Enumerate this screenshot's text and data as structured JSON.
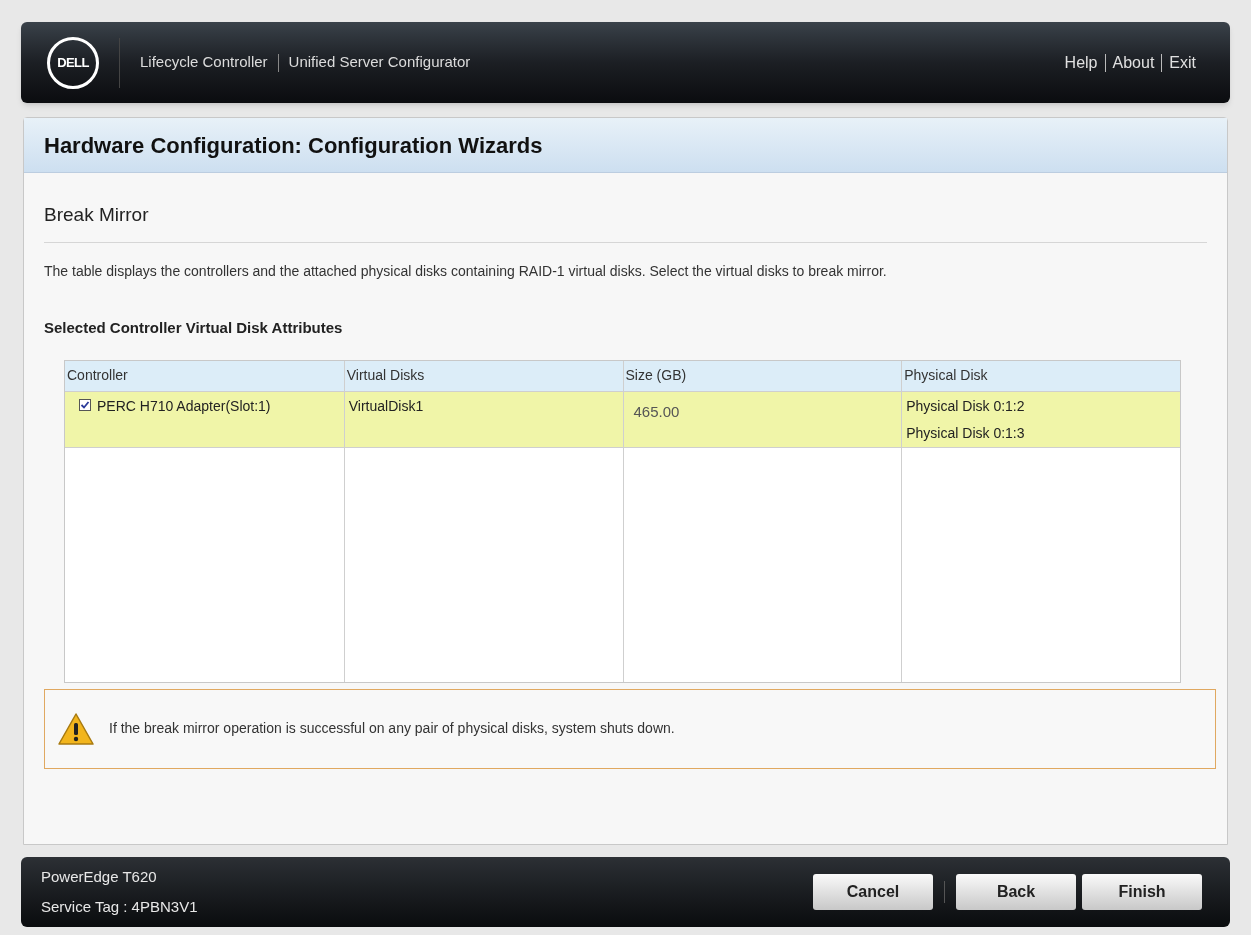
{
  "header": {
    "logo": "DELL",
    "titles": [
      "Lifecycle Controller",
      "Unified Server Configurator"
    ],
    "links": [
      "Help",
      "About",
      "Exit"
    ]
  },
  "page_title": "Hardware Configuration: Configuration Wizards",
  "section_title": "Break Mirror",
  "description": "The table displays the controllers and the attached physical disks containing RAID-1 virtual disks. Select the virtual disks to break mirror.",
  "table": {
    "title": "Selected Controller Virtual Disk Attributes",
    "columns": [
      "Controller",
      "Virtual Disks",
      "Size (GB)",
      "Physical Disk"
    ],
    "rows": [
      {
        "selected": true,
        "checked": true,
        "controller": "PERC H710 Adapter(Slot:1)",
        "virtual_disk": "VirtualDisk1",
        "size": "465.00",
        "physical_disks": [
          "Physical Disk 0:1:2",
          "Physical Disk 0:1:3"
        ]
      }
    ]
  },
  "warning": "If the break mirror operation is successful on any pair of physical disks, system shuts down.",
  "footer": {
    "model": "PowerEdge T620",
    "service_tag": "Service Tag : 4PBN3V1",
    "buttons": [
      "Cancel",
      "Back",
      "Finish"
    ]
  }
}
